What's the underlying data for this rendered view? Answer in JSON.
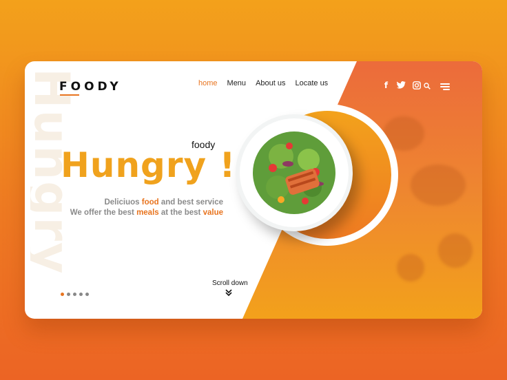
{
  "brand": {
    "logo": "FOODY"
  },
  "watermark": "Hungry",
  "nav": {
    "items": [
      {
        "label": "home",
        "active": true
      },
      {
        "label": "Menu",
        "active": false
      },
      {
        "label": "About us",
        "active": false
      },
      {
        "label": "Locate us",
        "active": false
      }
    ]
  },
  "header_icons": [
    "facebook-icon",
    "twitter-icon",
    "instagram-icon",
    "search-icon",
    "menu-icon"
  ],
  "hero": {
    "tag": "foody",
    "headline": "Hungry !",
    "line1_a": "Deliciuos ",
    "line1_b": "food",
    "line1_c": " and best service",
    "line2_a": "We offer the best ",
    "line2_b": "meals",
    "line2_c": " at the best ",
    "line2_d": "value"
  },
  "scroll": {
    "label": "Scroll down"
  },
  "pagination": {
    "count": 5,
    "active_index": 0
  },
  "colors": {
    "accent": "#e8741f",
    "headline": "#f0a21d",
    "bg_top": "#f3a11b",
    "bg_bottom": "#ec6424"
  }
}
